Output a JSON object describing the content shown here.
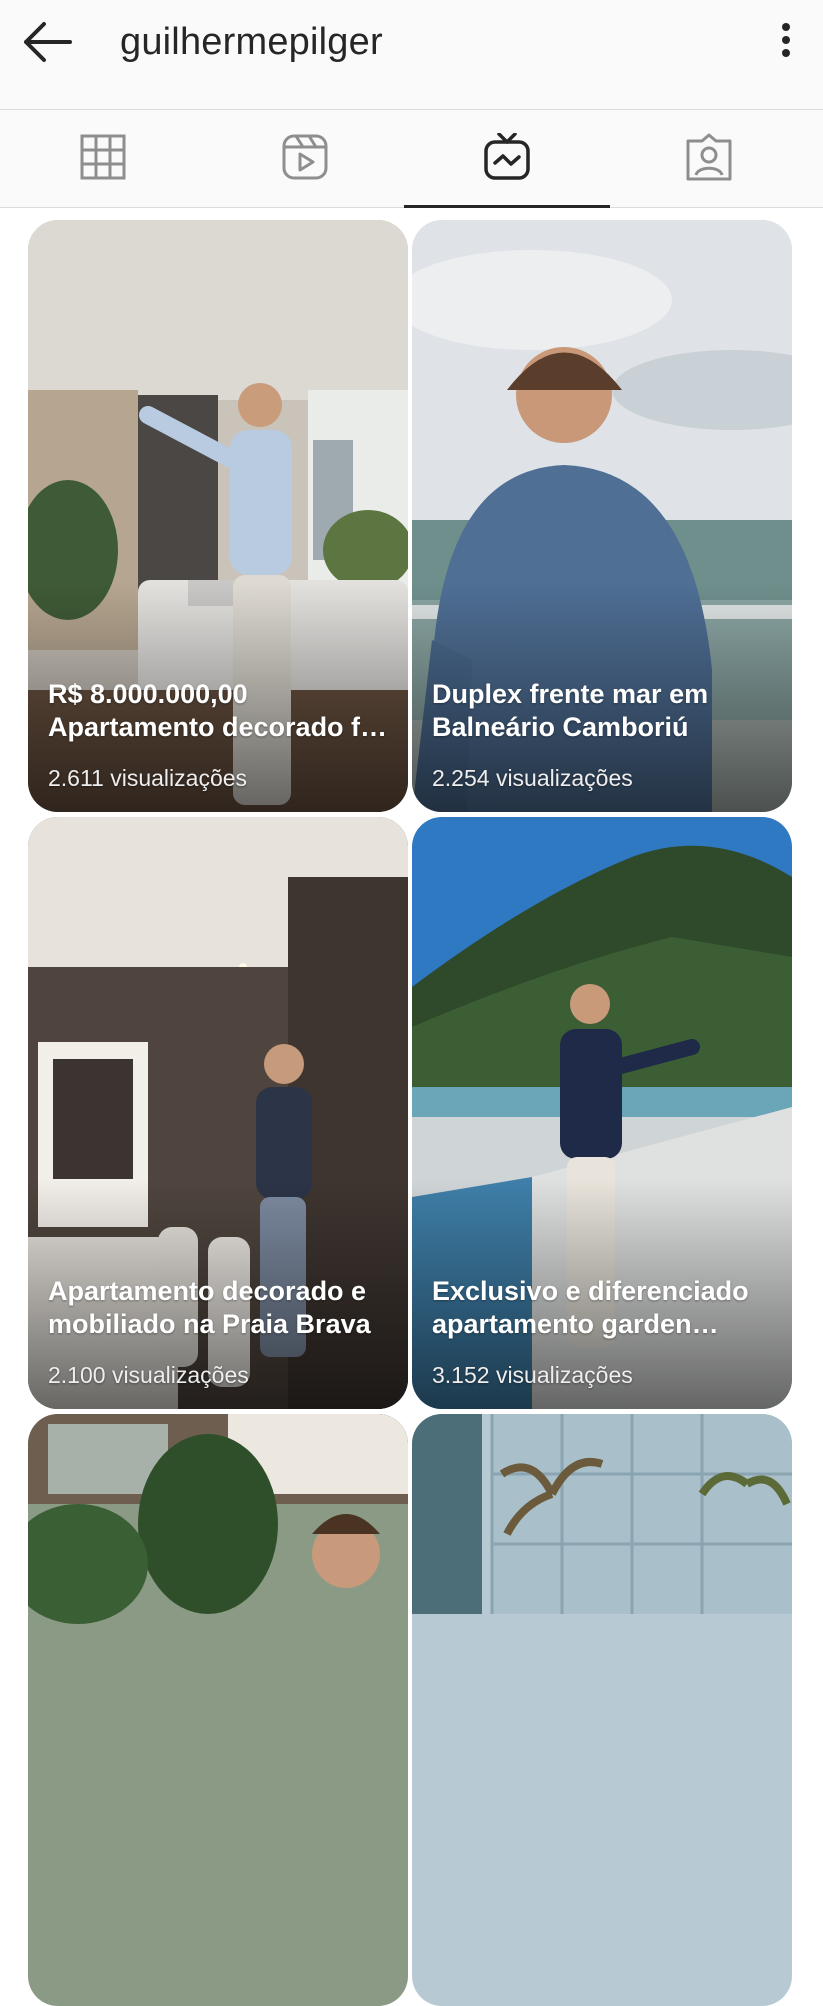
{
  "header": {
    "username": "guilhermepilger",
    "back_icon": "arrow-left-icon",
    "more_icon": "more-vertical-icon"
  },
  "tabs": [
    {
      "icon": "grid-icon",
      "active": false
    },
    {
      "icon": "reels-icon",
      "active": false
    },
    {
      "icon": "igtv-icon",
      "active": true
    },
    {
      "icon": "tagged-icon",
      "active": false
    }
  ],
  "videos": [
    {
      "caption": "R$ 8.000.000,00 Apartamento decorado f…",
      "views": "2.611 visualizações"
    },
    {
      "caption": "Duplex frente mar em Balneário Camboriú",
      "views": "2.254 visualizações"
    },
    {
      "caption": "Apartamento decorado e mobiliado na Praia Brava",
      "views": "2.100 visualizações"
    },
    {
      "caption": "Exclusivo e diferenciado apartamento garden dup…",
      "views": "3.152 visualizações"
    }
  ],
  "colors": {
    "bar_background": "#fafafa",
    "divider": "#dbdbdb",
    "icon": "#262626",
    "tab_icon": "#8e8e8e",
    "active_tab": "#262626"
  }
}
